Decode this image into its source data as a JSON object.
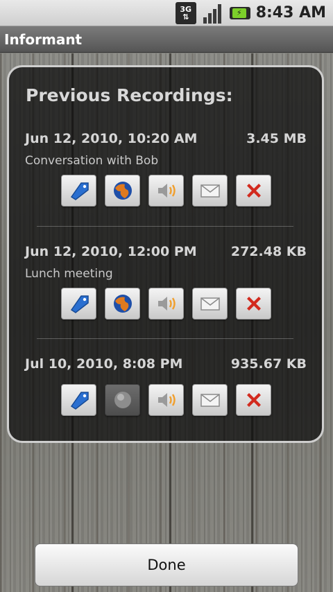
{
  "status_bar": {
    "network_label_top": "3G",
    "network_label_bottom": "⇅",
    "time": "8:43 AM"
  },
  "title_bar": {
    "title": "Informant"
  },
  "panel": {
    "title": "Previous Recordings:",
    "recordings": [
      {
        "date": "Jun 12, 2010, 10:20 AM",
        "size": "3.45 MB",
        "description": "Conversation with Bob",
        "web_enabled": true
      },
      {
        "date": "Jun 12, 2010, 12:00 PM",
        "size": "272.48 KB",
        "description": "Lunch meeting",
        "web_enabled": true
      },
      {
        "date": "Jul 10, 2010, 8:08 PM",
        "size": "935.67 KB",
        "description": "",
        "web_enabled": false
      }
    ],
    "action_icons": [
      "tag-icon",
      "globe-icon",
      "speaker-icon",
      "envelope-icon",
      "delete-icon"
    ]
  },
  "done_button": {
    "label": "Done"
  },
  "colors": {
    "tag_blue": "#2a6fd0",
    "globe_orange": "#e07a1f",
    "speaker_orange": "#f0a030",
    "delete_red": "#d22a1e"
  }
}
